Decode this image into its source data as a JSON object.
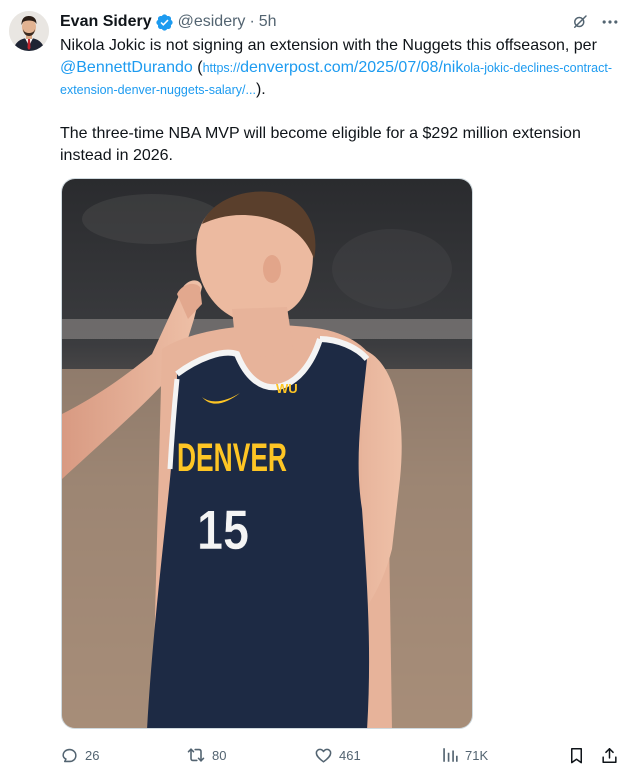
{
  "author": {
    "display_name": "Evan Sidery",
    "handle": "@esidery",
    "separator": "·",
    "time": "5h",
    "verified": true
  },
  "post": {
    "line1_text": "Nikola Jokic is not signing an extension with the Nuggets this offseason, per ",
    "mention": "@BennettDurando",
    "paren_open": " (",
    "link_prefix": "https://",
    "link_main": "denverpost.com/2025/07/08/nik",
    "link_tail": "ola-jokic-declines-contract-extension-denver-nuggets-salary/...",
    "paren_close": ").",
    "paragraph2": "The three-time NBA MVP will become eligible for a $292 million extension instead in 2026."
  },
  "jersey": {
    "team": "DENVER",
    "number": "15",
    "sponsor": "WU",
    "sponsor_sub": "Western Union"
  },
  "actions": {
    "replies": "26",
    "reposts": "80",
    "likes": "461",
    "views": "71K"
  },
  "icons": {
    "verified": "verified-badge-icon",
    "grok": "grok-icon",
    "more": "more-options-icon",
    "reply": "reply-icon",
    "repost": "repost-icon",
    "like": "like-icon",
    "views": "views-icon",
    "bookmark": "bookmark-icon",
    "share": "share-icon"
  },
  "colors": {
    "accent": "#1d9bf0",
    "text": "#0f1419",
    "muted": "#536471",
    "jersey_navy": "#1d2a44",
    "jersey_gold": "#fec524"
  }
}
